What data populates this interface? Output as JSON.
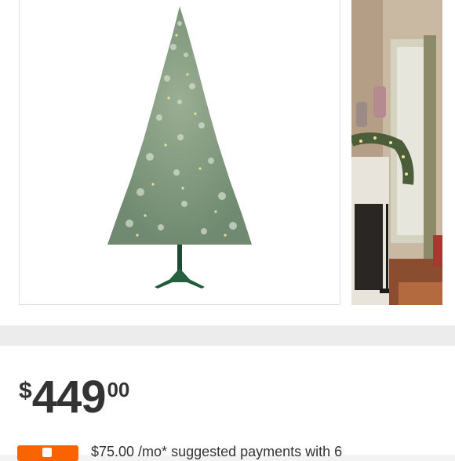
{
  "gallery": {
    "main_image_icon": "christmas-tree-product-image",
    "thumbnail_icon": "decorated-living-room-thumbnail"
  },
  "price": {
    "currency": "$",
    "dollars": "449",
    "cents": "00"
  },
  "financing": {
    "icon": "home-depot-card-icon",
    "text": "$75.00 /mo* suggested payments with 6"
  },
  "colors": {
    "accent_orange": "#f96302",
    "price_text": "#333333",
    "tree_green": "#7f9a80"
  }
}
